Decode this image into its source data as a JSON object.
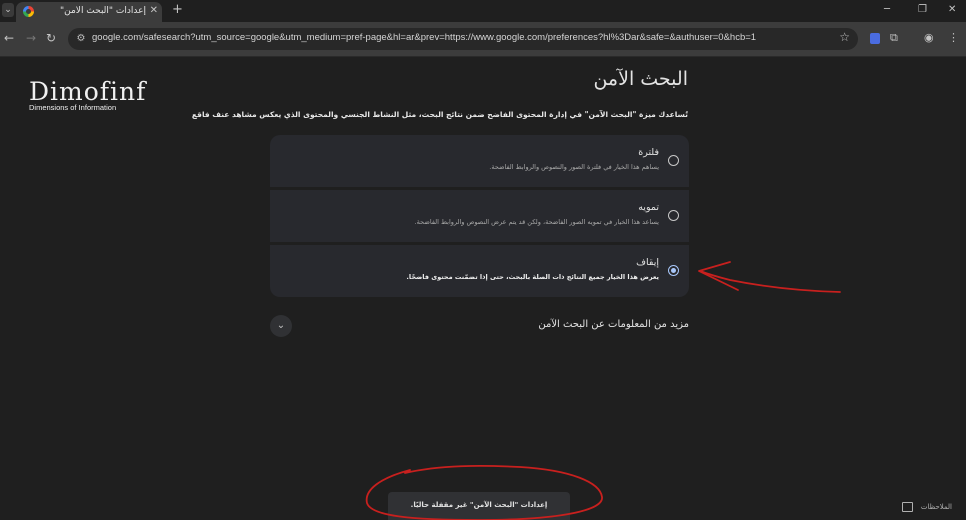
{
  "browser": {
    "tab_title": "إعدادات \"البحث الآمن\"",
    "tab_close": "✕",
    "new_tab": "+",
    "window_controls": [
      "─",
      "❐",
      "✕"
    ],
    "url": "google.com/safesearch?utm_source=google&utm_medium=pref-page&hl=ar&prev=https://www.google.com/preferences?hl%3Dar&safe=&authuser=0&hcb=1"
  },
  "logo": {
    "mark": "Dimofinf",
    "subtitle": "Dimensions of Information"
  },
  "page": {
    "title": "البحث الآمن",
    "description": "تُساعدك ميزة \"البحث الآمن\" في إدارة المحتوى الفاضح ضمن نتائج البحث، مثل النشاط الجنسي والمحتوى الذي يعكس مشاهد عنف فاقع"
  },
  "options": [
    {
      "label": "فلترة",
      "hint": "يساهم هذا الخيار في فلترة الصور والنصوص والروابط الفاضحة.",
      "selected": false
    },
    {
      "label": "تمويه",
      "hint": "يساعد هذا الخيار في تمويه الصور الفاضحة، ولكن قد يتم عرض النصوص والروابط الفاضحة.",
      "selected": false
    },
    {
      "label": "إيقاف",
      "hint": "يعرض هذا الخيار جميع النتائج ذات الصلة بالبحث، حتى إذا تضمّنت محتوى فاضحًا.",
      "selected": true
    }
  ],
  "more_info": "مزيد من المعلومات عن البحث الآمن",
  "toast": "إعدادات \"البحث الآمن\" غير مقفلة حاليًا.",
  "feedback": "الملاحظات",
  "colors": {
    "background": "#1f1f1f",
    "card": "#28292e",
    "radio_selected": "#a8c7fa",
    "annotation": "#c8201e"
  },
  "icons": [
    "back-icon",
    "forward-icon",
    "reload-icon",
    "tune-icon",
    "star-icon",
    "extension-icon",
    "puzzle-icon",
    "profile-icon",
    "menu-icon",
    "chevron-down-icon",
    "feedback-icon"
  ]
}
